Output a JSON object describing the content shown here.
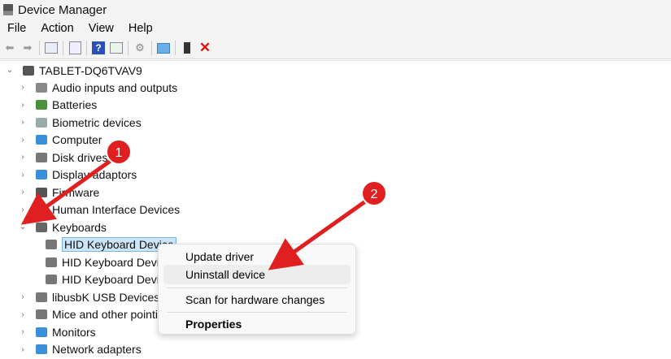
{
  "window": {
    "title": "Device Manager"
  },
  "menubar": [
    "File",
    "Action",
    "View",
    "Help"
  ],
  "toolbar": [
    "back-icon",
    "forward-icon",
    "show-hide-console-tree-icon",
    "properties-icon",
    "help-icon",
    "action-pane-icon",
    "update-driver-icon",
    "scan-hardware-icon",
    "add-legacy-icon",
    "uninstall-icon"
  ],
  "tree": {
    "root": "TABLET-DQ6TVAV9",
    "items": [
      {
        "label": "Audio inputs and outputs",
        "color": "#888"
      },
      {
        "label": "Batteries",
        "color": "#4a8f3a"
      },
      {
        "label": "Biometric devices",
        "color": "#9aa"
      },
      {
        "label": "Computer",
        "color": "#3a8fd8"
      },
      {
        "label": "Disk drives",
        "color": "#777"
      },
      {
        "label": "Display adaptors",
        "color": "#3a8fd8"
      },
      {
        "label": "Firmware",
        "color": "#555"
      },
      {
        "label": "Human Interface Devices",
        "color": "#777"
      },
      {
        "label": "Keyboards",
        "color": "#666",
        "expanded": true,
        "children": [
          "HID Keyboard Device",
          "HID Keyboard Device",
          "HID Keyboard Device"
        ]
      },
      {
        "label": "libusbK USB Devices",
        "color": "#777"
      },
      {
        "label": "Mice and other pointing devices",
        "color": "#777"
      },
      {
        "label": "Monitors",
        "color": "#3a8fd8"
      },
      {
        "label": "Network adapters",
        "color": "#3a8fd8"
      }
    ]
  },
  "context_menu": {
    "update": "Update driver",
    "uninstall": "Uninstall device",
    "scan": "Scan for hardware changes",
    "properties": "Properties"
  },
  "annotations": {
    "one": "1",
    "two": "2",
    "color": "#e02020"
  }
}
